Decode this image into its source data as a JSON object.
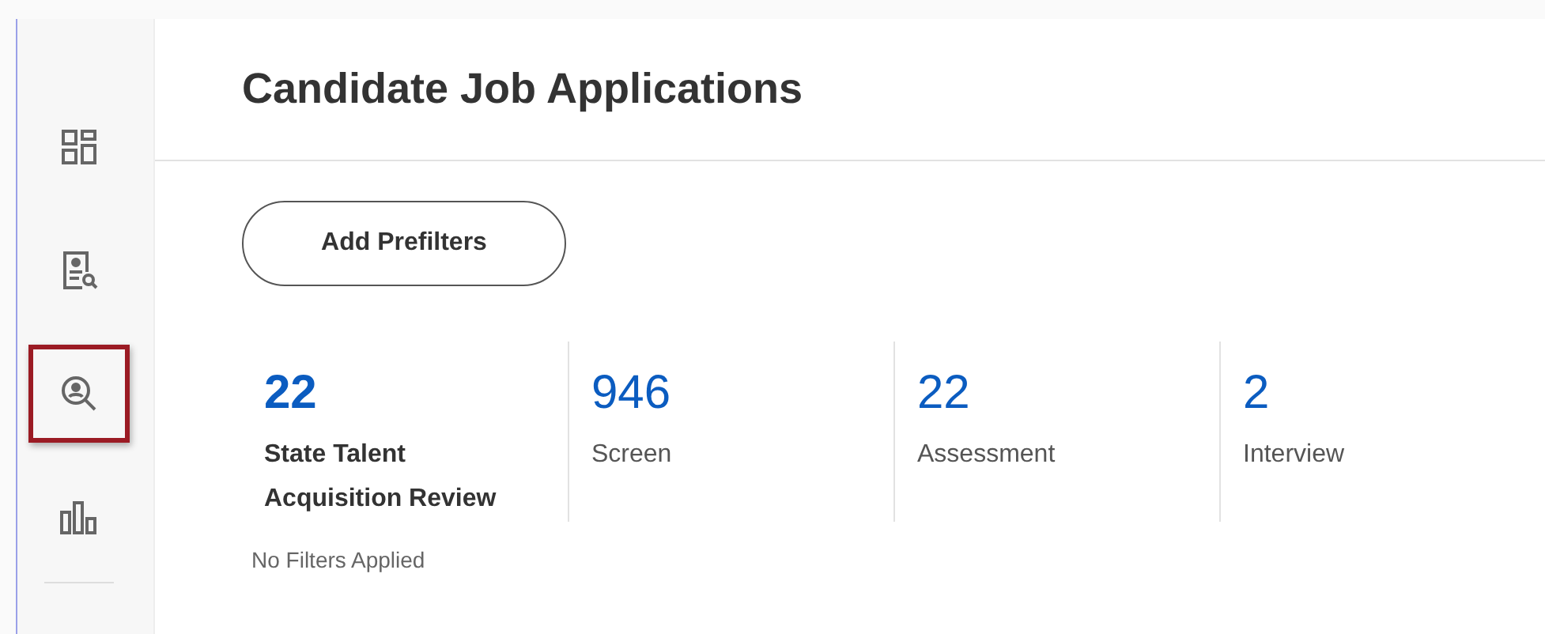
{
  "sidebar": {
    "items": [
      {
        "kind": "dashboard",
        "highlighted": false
      },
      {
        "kind": "document-search",
        "highlighted": false
      },
      {
        "kind": "person-search",
        "highlighted": true
      },
      {
        "kind": "chart",
        "highlighted": false
      }
    ]
  },
  "page": {
    "title": "Candidate Job Applications",
    "button": "Add Prefilters"
  },
  "stages": [
    {
      "count": "22",
      "label": "State Talent Acquisition Review",
      "selected": true
    },
    {
      "count": "946",
      "label": "Screen",
      "selected": false
    },
    {
      "count": "22",
      "label": "Assessment",
      "selected": false
    },
    {
      "count": "2",
      "label": "Interview",
      "selected": false
    }
  ],
  "filter_status": "No Filters Applied"
}
